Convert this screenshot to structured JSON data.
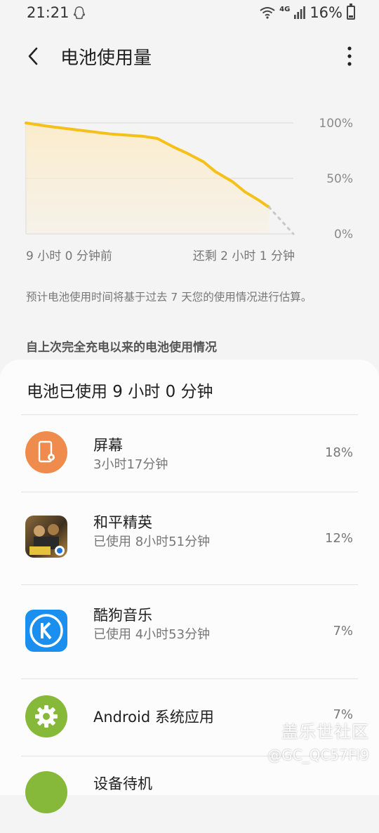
{
  "status_bar": {
    "time": "21:21",
    "network": "4G",
    "battery_pct": "16%"
  },
  "app_bar": {
    "title": "电池使用量"
  },
  "chart_data": {
    "type": "area",
    "x_labels": [
      "9 小时 0 分钟前",
      "还剩 2 小时 1 分钟"
    ],
    "y_ticks": [
      "100%",
      "50%",
      "0%"
    ],
    "ylim": [
      0,
      100
    ],
    "series": [
      {
        "values": [
          [
            0,
            100
          ],
          [
            0.9,
            97
          ],
          [
            2,
            94
          ],
          [
            3.5,
            90
          ],
          [
            4.8,
            88
          ],
          [
            5.4,
            86
          ],
          [
            6.1,
            78
          ],
          [
            6.6,
            73
          ],
          [
            7.3,
            65
          ],
          [
            7.8,
            56
          ],
          [
            8.5,
            47
          ],
          [
            9.0,
            38
          ],
          [
            9.6,
            30
          ],
          [
            10,
            24
          ]
        ]
      },
      {
        "values": [
          [
            10,
            24
          ],
          [
            11.0,
            0
          ]
        ]
      }
    ],
    "colors": {
      "line": "#f5c118",
      "fill": "#fbeccc",
      "projection": "#c8c8c8",
      "grid": "#dddddd"
    }
  },
  "hint": "预计电池使用时间将基于过去 7 天您的使用情况进行估算。",
  "section_title": "自上次完全充电以来的电池使用情况",
  "card": {
    "used_text": "电池已使用 9 小时 0 分钟",
    "items": [
      {
        "name": "屏幕",
        "sub": "3小时17分钟",
        "pct": "18%",
        "icon": "screen-icon"
      },
      {
        "name": "和平精英",
        "sub": "已使用 8小时51分钟",
        "pct": "12%",
        "icon": "game-icon"
      },
      {
        "name": "酷狗音乐",
        "sub": "已使用 4小时53分钟",
        "pct": "7%",
        "icon": "kugou-icon"
      },
      {
        "name": "Android 系统应用",
        "sub": "",
        "pct": "7%",
        "icon": "gear-icon"
      },
      {
        "name": "设备待机",
        "sub": "",
        "pct": "",
        "icon": "standby-icon"
      }
    ]
  },
  "watermark": {
    "line1": "盖乐世社区",
    "line2": "@GC_QC57FI9"
  }
}
